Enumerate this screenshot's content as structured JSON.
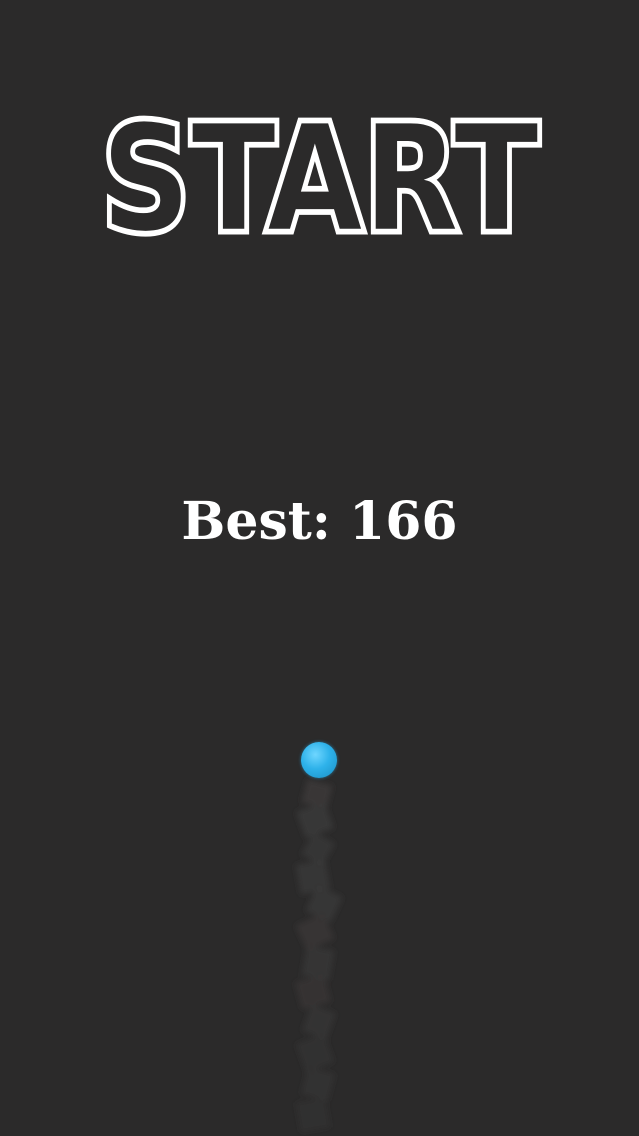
{
  "title": {
    "text": "START",
    "fill_color": "#2b2a2a",
    "stroke_color": "#ffffff"
  },
  "best_score": {
    "label": "Best:",
    "value": "166",
    "display": "Best: 166"
  },
  "player": {
    "color": "#2eb2ea"
  },
  "background_color": "#2b2a2a"
}
